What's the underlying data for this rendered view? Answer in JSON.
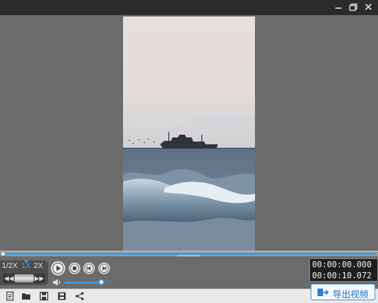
{
  "titlebar": {
    "buttons": [
      "minimize-icon",
      "restore-icon",
      "close-icon"
    ]
  },
  "player": {
    "speed_options": [
      "1/2X",
      "1X",
      "2X"
    ],
    "selected_speed": "1X",
    "progress": 0.0,
    "volume": 1.0
  },
  "timecode": {
    "current": "00:00:00.000",
    "duration": "00:00:10.072"
  },
  "toolbar": {
    "icons": [
      "new-project-icon",
      "open-folder-icon",
      "save-icon",
      "save-as-icon",
      "share-icon"
    ]
  },
  "export": {
    "label": "导出视频"
  },
  "colors": {
    "accent": "#3f9be0",
    "titlebar": "#2b2b2b",
    "stage": "#6b6b6b"
  }
}
